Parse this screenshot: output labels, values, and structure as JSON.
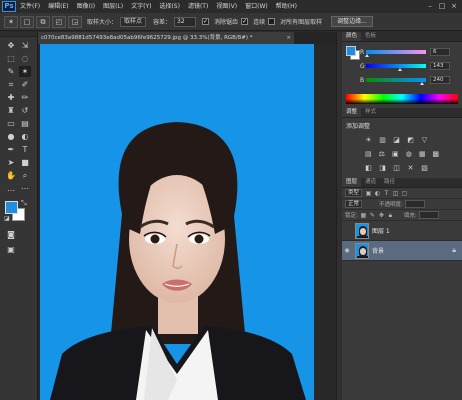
{
  "app": {
    "logo": "Ps"
  },
  "menu": [
    "文件(F)",
    "编辑(E)",
    "图像(I)",
    "图层(L)",
    "文字(Y)",
    "选择(S)",
    "滤镜(T)",
    "视图(V)",
    "窗口(W)",
    "帮助(H)"
  ],
  "window_controls": [
    "–",
    "□",
    "×"
  ],
  "options": {
    "sample_size_label": "取样大小：",
    "sample_size_value": "取样点",
    "tolerance_label": "容差：",
    "tolerance_value": "32",
    "antialias_label": "消除锯齿",
    "contiguous_label": "连续",
    "all_layers_label": "对所有图层取样",
    "refine_edge_button": "调整边缘..."
  },
  "document": {
    "tab_title": "c070ce83a9881d57493e8ad05ab96fe9625729.jpg @ 33.3%(背景, RGB/8#) *",
    "close": "×"
  },
  "colors": {
    "foreground": "#1f8ee0",
    "background": "#ffffff",
    "canvas_bg": "#1694e8"
  },
  "color_panel": {
    "tabs": [
      "颜色",
      "色板"
    ],
    "channels": [
      {
        "label": "R",
        "value": "6",
        "level": 0.02
      },
      {
        "label": "G",
        "value": "143",
        "level": 0.56
      },
      {
        "label": "B",
        "value": "240",
        "level": 0.94
      }
    ]
  },
  "adjustments": {
    "tabs": [
      "调整",
      "样式"
    ],
    "title": "添加调整",
    "row1": [
      "☀",
      "▥",
      "◪",
      "◩",
      "▽"
    ],
    "row2": [
      "▤",
      "⚖",
      "▣",
      "◍",
      "▦",
      "▩"
    ],
    "row3": [
      "◧",
      "◨",
      "◫",
      "✕",
      "▨"
    ]
  },
  "layers": {
    "tabs": [
      "图层",
      "通道",
      "路径"
    ],
    "kind_filter": "类型",
    "blend_mode": "正常",
    "opacity_label": "不透明度:",
    "lock_label": "锁定:",
    "fill_label": "填充:",
    "items": [
      {
        "name": "图层 1",
        "visible": false,
        "selected": false,
        "locked": false
      },
      {
        "name": "背景",
        "visible": true,
        "selected": true,
        "locked": true
      }
    ]
  }
}
